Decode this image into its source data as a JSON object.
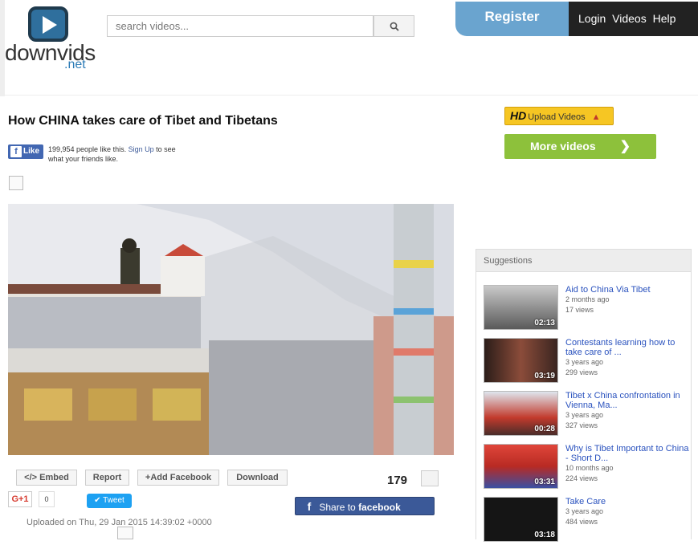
{
  "header": {
    "logo_name": "downvids",
    "logo_tld": ".net",
    "search_placeholder": "search videos...",
    "register": "Register",
    "nav": [
      "Login",
      "Videos",
      "Help"
    ]
  },
  "video": {
    "title": "How CHINA takes care of Tibet and Tibetans",
    "fb_like_label": "Like",
    "fb_count_text": "199,954 people like this.",
    "fb_signup": "Sign Up",
    "fb_tail": "to see what your friends like.",
    "buttons": [
      "</> Embed",
      "Report",
      "+Add Facebook",
      "Download"
    ],
    "gplus_label": "G+1",
    "gplus_count": "0",
    "tweet_label": "Tweet",
    "views": "179",
    "share_prefix": "Share to",
    "share_brand": "facebook",
    "uploaded": "Uploaded on Thu, 29 Jan 2015 14:39:02 +0000"
  },
  "sidebar": {
    "hd_badge": "HD",
    "upload_label": "Upload Videos",
    "more_label": "More videos",
    "suggestions_title": "Suggestions",
    "items": [
      {
        "title": "Aid to China Via Tibet",
        "age": "2 months ago",
        "views": "17 views",
        "duration": "02:13"
      },
      {
        "title": "Contestants learning how to take care of ...",
        "age": "3 years ago",
        "views": "299 views",
        "duration": "03:19"
      },
      {
        "title": "Tibet x China confrontation in Vienna, Ma...",
        "age": "3 years ago",
        "views": "327 views",
        "duration": "00:28"
      },
      {
        "title": "Why is Tibet Important to China - Short D...",
        "age": "10 months ago",
        "views": "224 views",
        "duration": "03:31"
      },
      {
        "title": "Take Care",
        "age": "3 years ago",
        "views": "484 views",
        "duration": "03:18"
      }
    ]
  },
  "colors": {
    "accent": "#6aa4cf",
    "green": "#8dc13b",
    "facebook": "#3b5998"
  }
}
